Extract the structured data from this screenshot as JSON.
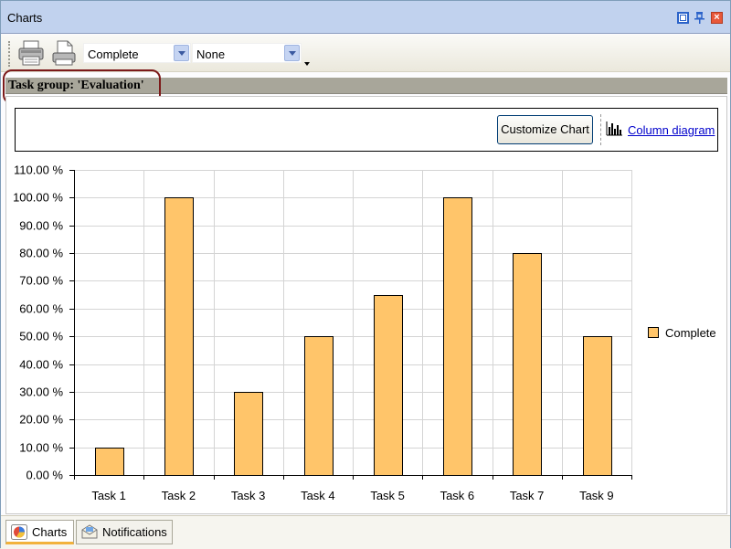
{
  "window": {
    "title": "Charts"
  },
  "toolbar": {
    "print_icon": "printer-icon",
    "preview_icon": "print-preview-icon",
    "combo1_value": "Complete",
    "combo2_value": "None"
  },
  "group": {
    "title": "Task group: 'Evaluation'"
  },
  "actions": {
    "customize_label": "Customize Chart",
    "column_diagram_label": "Column diagram"
  },
  "chart_data": {
    "type": "bar",
    "categories": [
      "Task 1",
      "Task 2",
      "Task 3",
      "Task 4",
      "Task 5",
      "Task 6",
      "Task 7",
      "Task 9"
    ],
    "series": [
      {
        "name": "Complete",
        "values": [
          10,
          100,
          30,
          50,
          65,
          100,
          80,
          50
        ],
        "color": "#ffc56a"
      }
    ],
    "yticks": [
      "0.00 %",
      "10.00 %",
      "20.00 %",
      "30.00 %",
      "40.00 %",
      "50.00 %",
      "60.00 %",
      "70.00 %",
      "80.00 %",
      "90.00 %",
      "100.00 %",
      "110.00 %"
    ],
    "ylim": [
      0,
      110
    ],
    "grid": true,
    "legend_position": "right"
  },
  "tabs": [
    {
      "label": "Charts",
      "icon": "chart-pie-icon",
      "active": true
    },
    {
      "label": "Notifications",
      "icon": "envelope-icon",
      "active": false
    }
  ]
}
